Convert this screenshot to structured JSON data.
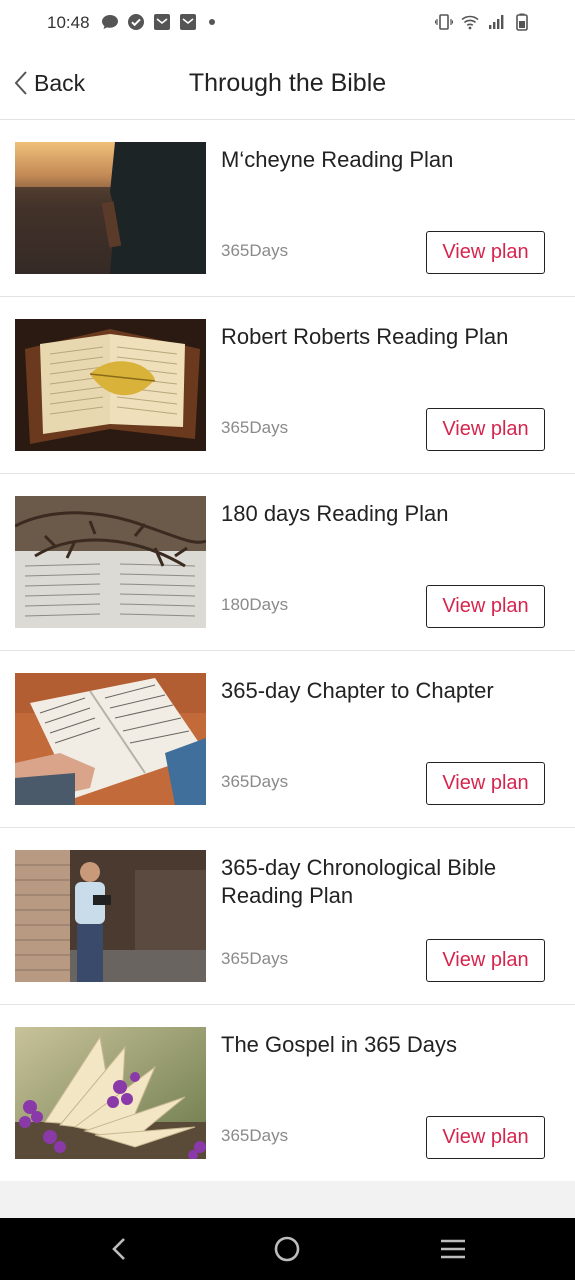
{
  "status": {
    "time": "10:48",
    "left_icons": [
      "chat-bubble-icon",
      "check-circle-icon",
      "mail-icon",
      "mail-icon",
      "dot-icon"
    ],
    "right_icons": [
      "vibrate-icon",
      "wifi-icon",
      "signal-icon",
      "battery-icon"
    ]
  },
  "header": {
    "back_label": "Back",
    "title": "Through the Bible"
  },
  "plans": [
    {
      "title": "M‘cheyne Reading Plan",
      "days": "365Days",
      "button": "View plan",
      "image": "person-holding-bible-field-photo"
    },
    {
      "title": "Robert Roberts Reading Plan",
      "days": "365Days",
      "button": "View plan",
      "image": "open-bible-with-leaf-photo"
    },
    {
      "title": "180 days Reading Plan",
      "days": "180Days",
      "button": "View plan",
      "image": "bible-with-thorns-photo"
    },
    {
      "title": "365-day Chapter to Chapter",
      "days": "365Days",
      "button": "View plan",
      "image": "hand-on-open-bible-photo"
    },
    {
      "title": "365-day Chronological Bible Reading Plan",
      "days": "365Days",
      "button": "View plan",
      "image": "man-reading-in-hallway-photo"
    },
    {
      "title": "The Gospel in 365 Days",
      "days": "365Days",
      "button": "View plan",
      "image": "book-with-purple-flowers-photo"
    }
  ],
  "nav": {
    "icons": [
      "back-nav-icon",
      "home-nav-icon",
      "recents-nav-icon"
    ]
  },
  "colors": {
    "accent": "#d6254d",
    "text": "#222222",
    "muted": "#8a8a8a",
    "divider": "#e3e3e3"
  }
}
